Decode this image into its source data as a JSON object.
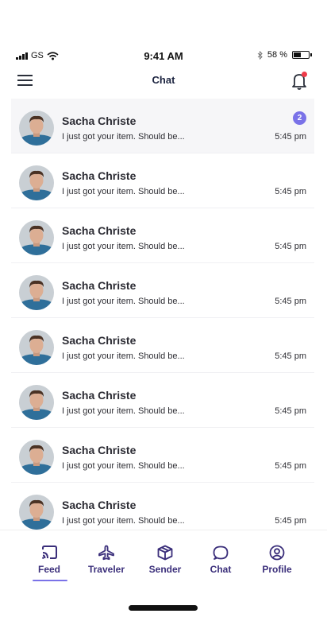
{
  "status_bar": {
    "carrier": "GS",
    "time": "9:41 AM",
    "battery_percent": "58 %"
  },
  "header": {
    "title": "Chat",
    "has_notification": true
  },
  "chats": [
    {
      "name": "Sacha Christe",
      "preview": "I just got your item. Should be...",
      "time": "5:45 pm",
      "unread": "2"
    },
    {
      "name": "Sacha Christe",
      "preview": "I just got your item. Should be...",
      "time": "5:45 pm",
      "unread": ""
    },
    {
      "name": "Sacha Christe",
      "preview": "I just got your item. Should be...",
      "time": "5:45 pm",
      "unread": ""
    },
    {
      "name": "Sacha Christe",
      "preview": "I just got your item. Should be...",
      "time": "5:45 pm",
      "unread": ""
    },
    {
      "name": "Sacha Christe",
      "preview": "I just got your item. Should be...",
      "time": "5:45 pm",
      "unread": ""
    },
    {
      "name": "Sacha Christe",
      "preview": "I just got your item. Should be...",
      "time": "5:45 pm",
      "unread": ""
    },
    {
      "name": "Sacha Christe",
      "preview": "I just got your item. Should be...",
      "time": "5:45 pm",
      "unread": ""
    },
    {
      "name": "Sacha Christe",
      "preview": "I just got your item. Should be...",
      "time": "5:45 pm",
      "unread": ""
    }
  ],
  "tabs": [
    {
      "label": "Feed",
      "icon": "cast-icon",
      "active": true
    },
    {
      "label": "Traveler",
      "icon": "plane-icon",
      "active": false
    },
    {
      "label": "Sender",
      "icon": "box-icon",
      "active": false
    },
    {
      "label": "Chat",
      "icon": "chat-bubble-icon",
      "active": false
    },
    {
      "label": "Profile",
      "icon": "profile-icon",
      "active": false
    }
  ],
  "colors": {
    "accent": "#7a72e8",
    "tab_text": "#3a2e7a",
    "notification_dot": "#ef3b4a",
    "active_row": "#f6f6f8"
  }
}
